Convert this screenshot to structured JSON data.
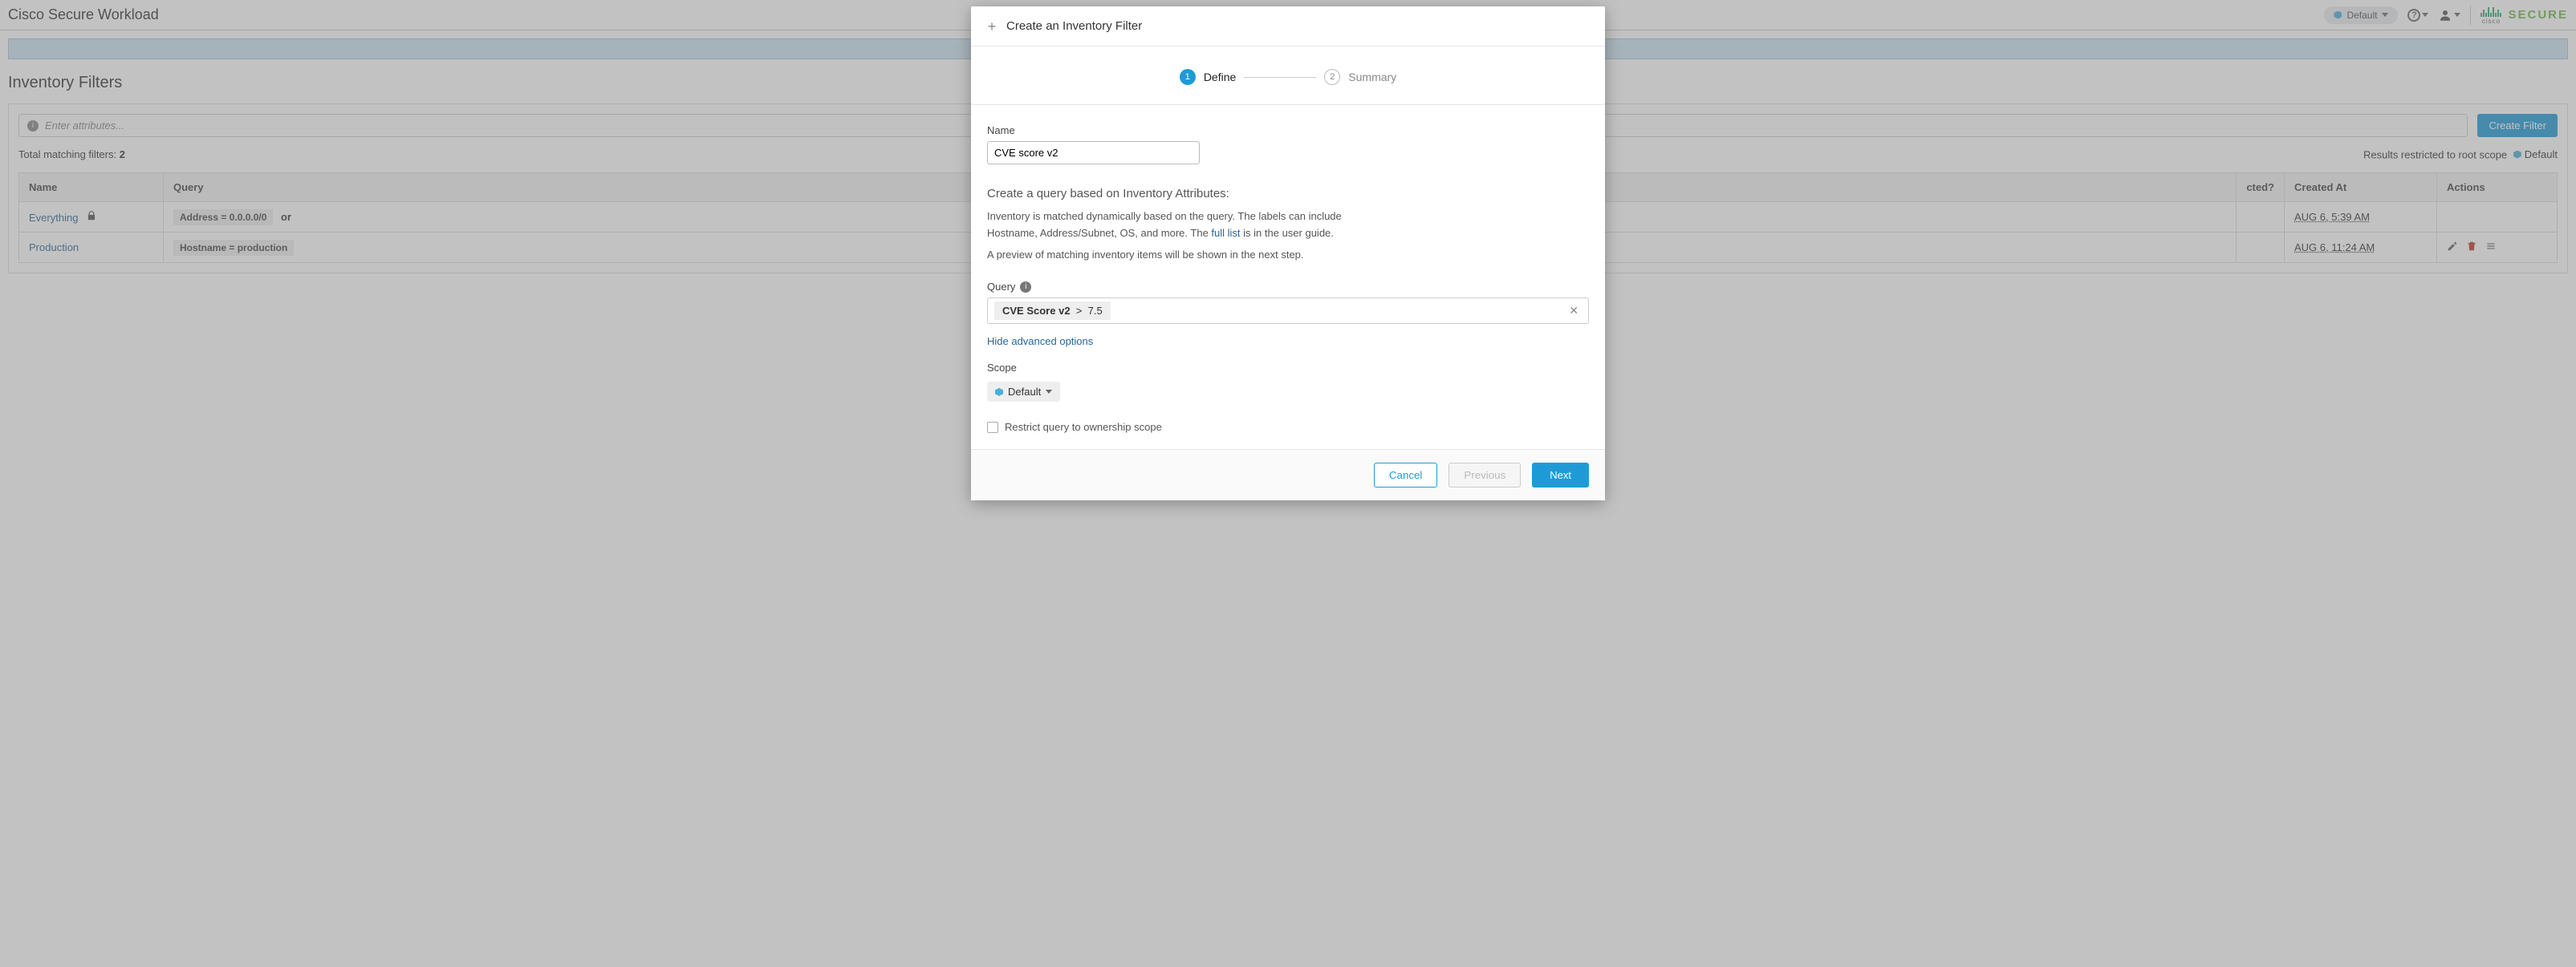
{
  "header": {
    "app_title": "Cisco Secure Workload",
    "scope_label": "Default",
    "brand_prefix": "cisco",
    "brand_suffix": "SECURE"
  },
  "page": {
    "title": "Inventory Filters",
    "attr_search_placeholder": "Enter attributes...",
    "create_filter_btn": "Create Filter",
    "total_matching_prefix": "Total matching filters: ",
    "total_matching_count": "2",
    "results_restricted_label": "Results restricted to root scope",
    "root_scope_value": "Default"
  },
  "table": {
    "headers": {
      "name": "Name",
      "query": "Query",
      "restricted": "cted?",
      "created_at": "Created At",
      "actions": "Actions"
    },
    "rows": [
      {
        "name": "Everything",
        "locked": true,
        "query_parts": [
          "Address = 0.0.0.0/0",
          "or"
        ],
        "created_at": "AUG 6, 5:39 AM",
        "editable": false
      },
      {
        "name": "Production",
        "locked": false,
        "query_parts": [
          "Hostname = production"
        ],
        "created_at": "AUG 6, 11:24 AM",
        "editable": true
      }
    ]
  },
  "modal": {
    "title": "Create an Inventory Filter",
    "steps": {
      "define": "Define",
      "summary": "Summary"
    },
    "name_label": "Name",
    "name_value": "CVE score v2",
    "query_section_title": "Create a query based on Inventory Attributes:",
    "desc_line1a": "Inventory is matched dynamically based on the query. The labels can include Hostname, Address/Subnet, OS, and more. The ",
    "desc_link": "full list",
    "desc_line1b": " is in the user guide.",
    "desc_line2": "A preview of matching inventory items will be shown in the next step.",
    "query_label": "Query",
    "query_chip_field": "CVE Score v2",
    "query_chip_op": ">",
    "query_chip_value": "7.5",
    "adv_link": "Hide advanced options",
    "scope_label": "Scope",
    "scope_value": "Default",
    "restrict_label": "Restrict query to ownership scope",
    "btn_cancel": "Cancel",
    "btn_previous": "Previous",
    "btn_next": "Next"
  }
}
